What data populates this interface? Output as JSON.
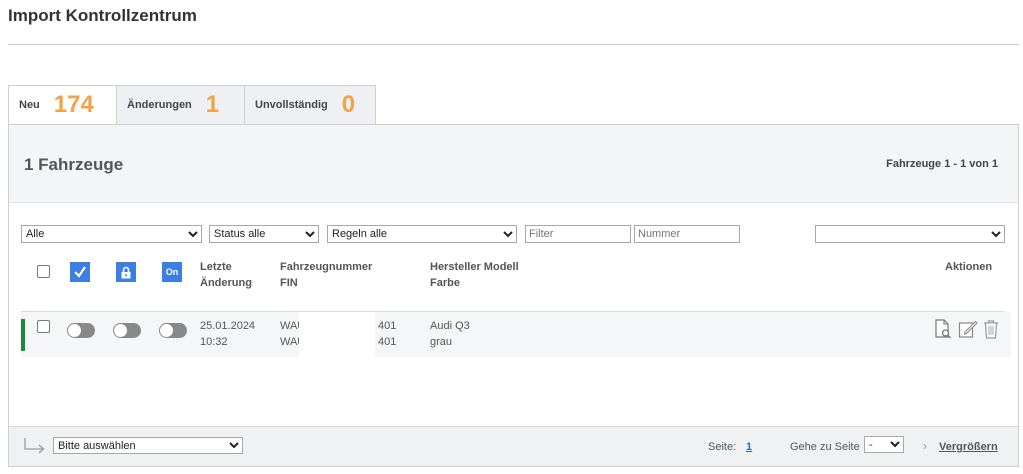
{
  "page": {
    "title": "Import Kontrollzentrum"
  },
  "tabs": [
    {
      "label": "Neu",
      "count": "174"
    },
    {
      "label": "Änderungen",
      "count": "1"
    },
    {
      "label": "Unvollständig",
      "count": "0"
    }
  ],
  "panel": {
    "count_title": "1 Fahrzeuge",
    "range_text": "Fahrzeuge 1 - 1 von 1"
  },
  "filters": {
    "all_value": "Alle",
    "status_value": "Status alle",
    "rules_value": "Regeln alle",
    "filter_placeholder": "Filter",
    "number_placeholder": "Nummer",
    "right_value": ""
  },
  "header": {
    "on_label": "On",
    "col_change_1": "Letzte",
    "col_change_2": "Änderung",
    "col_vehicle_1": "Fahrzeugnummer",
    "col_vehicle_2": "FIN",
    "col_model_1": "Hersteller Modell",
    "col_model_2": "Farbe",
    "col_actions": "Aktionen"
  },
  "rows": [
    {
      "date": "25.01.2024",
      "time": "10:32",
      "number_prefix": "WAU",
      "number_suffix": "401",
      "fin_prefix": "WAU",
      "fin_suffix": "401",
      "model": "Audi Q3",
      "color": "grau"
    }
  ],
  "footer": {
    "bulk_value": "Bitte auswählen",
    "page_label": "Seite:",
    "page_num": "1",
    "goto_label": "Gehe zu Seite",
    "goto_value": "-",
    "enlarge": "Vergrößern"
  },
  "colors": {
    "accent_orange": "#f0a445",
    "icon_blue": "#3d7ee3",
    "row_marker_green": "#1a8a3a"
  }
}
